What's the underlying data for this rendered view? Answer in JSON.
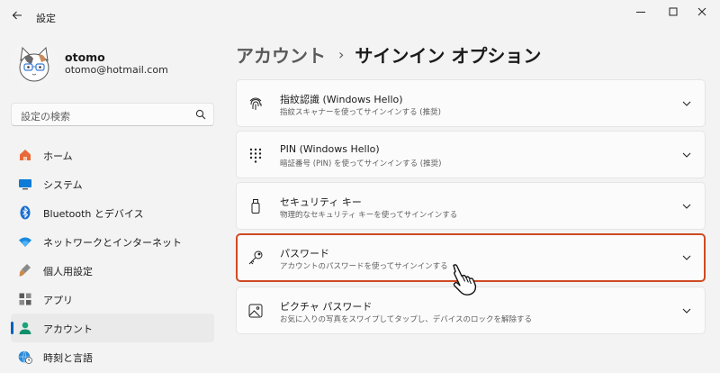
{
  "window": {
    "title": "設定"
  },
  "user": {
    "name": "otomo",
    "email": "otomo@hotmail.com"
  },
  "search": {
    "placeholder": "設定の検索"
  },
  "nav": {
    "items": [
      {
        "label": "ホーム",
        "icon": "home-icon"
      },
      {
        "label": "システム",
        "icon": "system-icon"
      },
      {
        "label": "Bluetooth とデバイス",
        "icon": "bluetooth-icon"
      },
      {
        "label": "ネットワークとインターネット",
        "icon": "wifi-icon"
      },
      {
        "label": "個人用設定",
        "icon": "brush-icon"
      },
      {
        "label": "アプリ",
        "icon": "apps-icon"
      },
      {
        "label": "アカウント",
        "icon": "account-icon",
        "active": true
      },
      {
        "label": "時刻と言語",
        "icon": "globe-clock-icon"
      }
    ]
  },
  "breadcrumb": {
    "parent": "アカウント",
    "separator": "›",
    "current": "サインイン オプション"
  },
  "options": [
    {
      "title": "指紋認識 (Windows Hello)",
      "description": "指紋スキャナーを使ってサインインする (推奨)",
      "icon": "fingerprint-icon"
    },
    {
      "title": "PIN (Windows Hello)",
      "description": "暗証番号 (PIN) を使ってサインインする (推奨)",
      "icon": "pin-keypad-icon"
    },
    {
      "title": "セキュリティ キー",
      "description": "物理的なセキュリティ キーを使ってサインインする",
      "icon": "usb-key-icon"
    },
    {
      "title": "パスワード",
      "description": "アカウントのパスワードを使ってサインインする",
      "icon": "key-icon",
      "highlighted": true
    },
    {
      "title": "ピクチャ パスワード",
      "description": "お気に入りの写真をスワイプしてタップし、デバイスのロックを解除する",
      "icon": "picture-icon"
    }
  ],
  "colors": {
    "accent": "#005fb8",
    "highlight_border": "#d04a22",
    "background": "#f3f3f3",
    "card": "#fbfbfb"
  }
}
